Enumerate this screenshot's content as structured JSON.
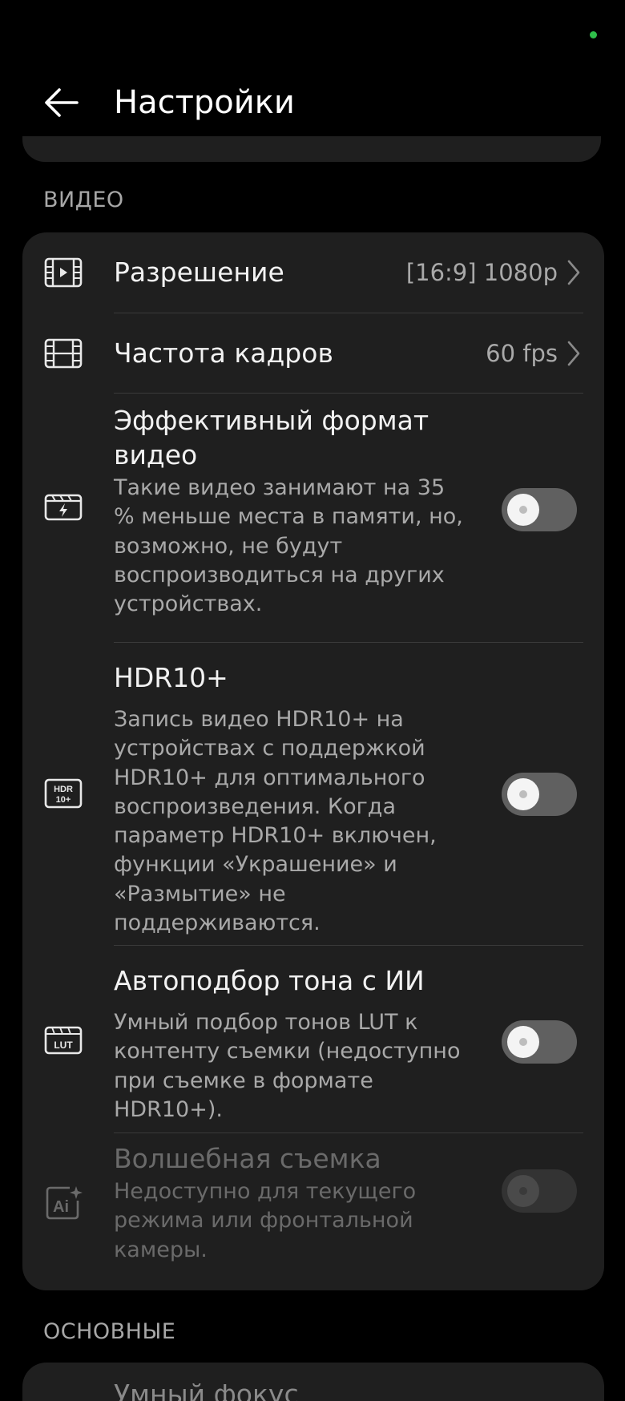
{
  "header": {
    "title": "Настройки"
  },
  "sections": {
    "video_label": "ВИДЕО",
    "basic_label": "ОСНОВНЫЕ"
  },
  "video": {
    "resolution": {
      "title": "Разрешение",
      "value": "[16:9] 1080p",
      "icon": "video-resolution-icon"
    },
    "frame_rate": {
      "title": "Частота кадров",
      "value": "60 fps",
      "icon": "film-strip-icon"
    },
    "efficient_format": {
      "title": "Эффективный формат видео",
      "desc": "Такие видео занимают на 35 % меньше места в памяти, но, возможно, не будут воспроизводиться на других устройствах.",
      "enabled": false,
      "icon": "clapper-bolt-icon"
    },
    "hdr10": {
      "title": "HDR10+",
      "desc": "Запись видео HDR10+ на устройствах с поддержкой HDR10+ для оптимального воспроизведения. Когда параметр HDR10+ включен, функции «Украшение» и «Размытие» не поддерживаются.",
      "enabled": false,
      "icon_label": "HDR\n10+",
      "icon": "hdr10-icon"
    },
    "ai_tone": {
      "title": "Автоподбор тона с ИИ",
      "desc": "Умный подбор тонов LUT к контенту съемки (недоступно при съемке в формате HDR10+).",
      "enabled": false,
      "icon_label": "LUT",
      "icon": "lut-icon"
    },
    "magic_shot": {
      "title": "Волшебная съемка",
      "desc": "Недоступно для текущего режима или фронтальной камеры.",
      "enabled": false,
      "disabled": true,
      "icon": "ai-sparkle-icon"
    }
  },
  "basic": {
    "smart_focus": {
      "title": "Умный фокус"
    }
  },
  "colors": {
    "background": "#000000",
    "card": "#1f1f1f",
    "status_dot": "#2fbf4a"
  }
}
